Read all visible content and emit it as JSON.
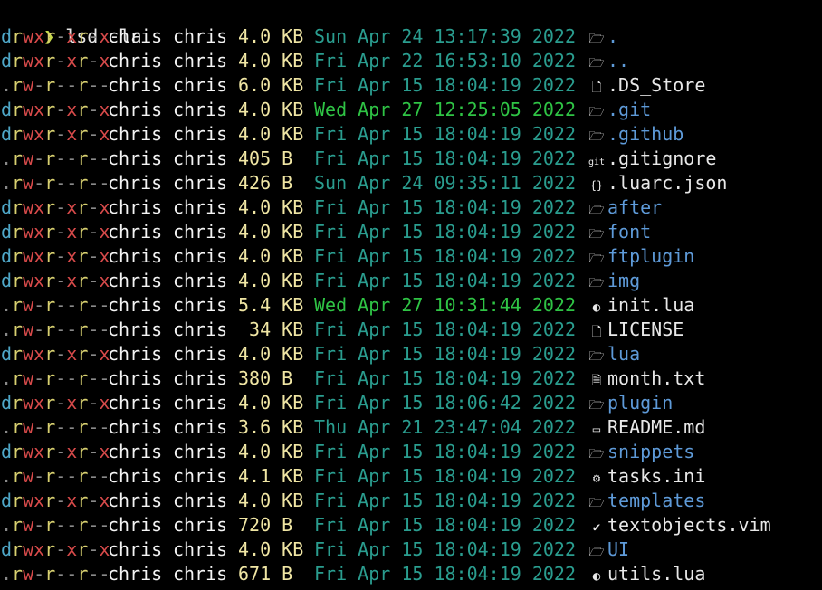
{
  "prompt": {
    "symbol": "❯",
    "command": "lsd -la"
  },
  "colors": {
    "background": "#000000",
    "prompt": "#c6d84b",
    "dir_flag": "#4fa8c9",
    "read": "#d8d070",
    "write_exec": "#d74a4a",
    "size": "#f0e6a4",
    "date_old": "#2a9d8f",
    "date_recent": "#2fc445",
    "dir_name": "#5e9ad8",
    "file_name": "#e8e8e8"
  },
  "entries": [
    {
      "perm": "drwxr-xr-x",
      "user": "chris",
      "group": "chris",
      "size": "4.0 KB",
      "date": "Sun Apr 24 13:17:39 2022",
      "icon": "folder-icon",
      "name": ".",
      "dir": true
    },
    {
      "perm": "drwxr-xr-x",
      "user": "chris",
      "group": "chris",
      "size": "4.0 KB",
      "date": "Fri Apr 22 16:53:10 2022",
      "icon": "folder-icon",
      "name": "..",
      "dir": true
    },
    {
      "perm": ".rw-r--r--",
      "user": "chris",
      "group": "chris",
      "size": "6.0 KB",
      "date": "Fri Apr 15 18:04:19 2022",
      "icon": "file-icon",
      "name": ".DS_Store",
      "dir": false
    },
    {
      "perm": "drwxr-xr-x",
      "user": "chris",
      "group": "chris",
      "size": "4.0 KB",
      "date": "Wed Apr 27 12:25:05 2022",
      "icon": "folder-icon",
      "name": ".git",
      "dir": true,
      "recent": true
    },
    {
      "perm": "drwxr-xr-x",
      "user": "chris",
      "group": "chris",
      "size": "4.0 KB",
      "date": "Fri Apr 15 18:04:19 2022",
      "icon": "folder-icon",
      "name": ".github",
      "dir": true
    },
    {
      "perm": ".rw-r--r--",
      "user": "chris",
      "group": "chris",
      "size": "405 B",
      "date": "Fri Apr 15 18:04:19 2022",
      "icon": "git-icon",
      "name": ".gitignore",
      "dir": false
    },
    {
      "perm": ".rw-r--r--",
      "user": "chris",
      "group": "chris",
      "size": "426 B",
      "date": "Sun Apr 24 09:35:11 2022",
      "icon": "json-icon",
      "name": ".luarc.json",
      "dir": false
    },
    {
      "perm": "drwxr-xr-x",
      "user": "chris",
      "group": "chris",
      "size": "4.0 KB",
      "date": "Fri Apr 15 18:04:19 2022",
      "icon": "folder-icon",
      "name": "after",
      "dir": true
    },
    {
      "perm": "drwxr-xr-x",
      "user": "chris",
      "group": "chris",
      "size": "4.0 KB",
      "date": "Fri Apr 15 18:04:19 2022",
      "icon": "folder-icon",
      "name": "font",
      "dir": true
    },
    {
      "perm": "drwxr-xr-x",
      "user": "chris",
      "group": "chris",
      "size": "4.0 KB",
      "date": "Fri Apr 15 18:04:19 2022",
      "icon": "folder-icon",
      "name": "ftplugin",
      "dir": true
    },
    {
      "perm": "drwxr-xr-x",
      "user": "chris",
      "group": "chris",
      "size": "4.0 KB",
      "date": "Fri Apr 15 18:04:19 2022",
      "icon": "folder-icon",
      "name": "img",
      "dir": true
    },
    {
      "perm": ".rw-r--r--",
      "user": "chris",
      "group": "chris",
      "size": "5.4 KB",
      "date": "Wed Apr 27 10:31:44 2022",
      "icon": "lua-icon",
      "name": "init.lua",
      "dir": false,
      "recent": true
    },
    {
      "perm": ".rw-r--r--",
      "user": "chris",
      "group": "chris",
      "size": " 34 KB",
      "date": "Fri Apr 15 18:04:19 2022",
      "icon": "file-icon",
      "name": "LICENSE",
      "dir": false
    },
    {
      "perm": "drwxr-xr-x",
      "user": "chris",
      "group": "chris",
      "size": "4.0 KB",
      "date": "Fri Apr 15 18:04:19 2022",
      "icon": "folder-icon",
      "name": "lua",
      "dir": true
    },
    {
      "perm": ".rw-r--r--",
      "user": "chris",
      "group": "chris",
      "size": "380 B",
      "date": "Fri Apr 15 18:04:19 2022",
      "icon": "text-file-icon",
      "name": "month.txt",
      "dir": false
    },
    {
      "perm": "drwxr-xr-x",
      "user": "chris",
      "group": "chris",
      "size": "4.0 KB",
      "date": "Fri Apr 15 18:06:42 2022",
      "icon": "folder-icon",
      "name": "plugin",
      "dir": true
    },
    {
      "perm": ".rw-r--r--",
      "user": "chris",
      "group": "chris",
      "size": "3.6 KB",
      "date": "Thu Apr 21 23:47:04 2022",
      "icon": "markdown-icon",
      "name": "README.md",
      "dir": false
    },
    {
      "perm": "drwxr-xr-x",
      "user": "chris",
      "group": "chris",
      "size": "4.0 KB",
      "date": "Fri Apr 15 18:04:19 2022",
      "icon": "folder-icon",
      "name": "snippets",
      "dir": true
    },
    {
      "perm": ".rw-r--r--",
      "user": "chris",
      "group": "chris",
      "size": "4.1 KB",
      "date": "Fri Apr 15 18:04:19 2022",
      "icon": "gear-icon",
      "name": "tasks.ini",
      "dir": false
    },
    {
      "perm": "drwxr-xr-x",
      "user": "chris",
      "group": "chris",
      "size": "4.0 KB",
      "date": "Fri Apr 15 18:04:19 2022",
      "icon": "folder-icon",
      "name": "templates",
      "dir": true
    },
    {
      "perm": ".rw-r--r--",
      "user": "chris",
      "group": "chris",
      "size": "720 B",
      "date": "Fri Apr 15 18:04:19 2022",
      "icon": "vim-icon",
      "name": "textobjects.vim",
      "dir": false
    },
    {
      "perm": "drwxr-xr-x",
      "user": "chris",
      "group": "chris",
      "size": "4.0 KB",
      "date": "Fri Apr 15 18:04:19 2022",
      "icon": "folder-icon",
      "name": "UI",
      "dir": true
    },
    {
      "perm": ".rw-r--r--",
      "user": "chris",
      "group": "chris",
      "size": "671 B",
      "date": "Fri Apr 15 18:04:19 2022",
      "icon": "lua-icon",
      "name": "utils.lua",
      "dir": false
    }
  ]
}
